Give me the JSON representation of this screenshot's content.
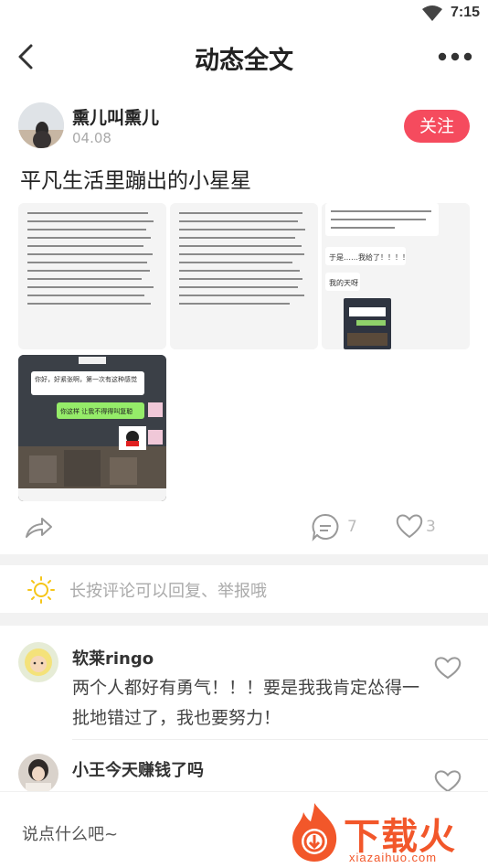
{
  "status_bar": {
    "time": "7:15"
  },
  "nav": {
    "title": "动态全文"
  },
  "post": {
    "author_name": "熏儿叫熏儿",
    "date": "04.08",
    "follow_label": "关注",
    "title": "平凡生活里蹦出的小星星",
    "comment_count": "7",
    "like_count": "3"
  },
  "screenshot_texts": {
    "chat_greeting": "你好，好紧张啊，第一次有这种感觉",
    "chat_reply": "你这样 让我不得得叫复聪",
    "reply_1": "于是……我给了！！！！",
    "reply_2": "我的天呀"
  },
  "tip": {
    "text": "长按评论可以回复、举报哦"
  },
  "comments": [
    {
      "name": "软莱ringo",
      "text": "两个人都好有勇气！！！要是我我肯定怂得一批地错过了，我也要努力！"
    },
    {
      "name": "小王今天赚钱了吗",
      "text": ""
    }
  ],
  "input": {
    "placeholder": "说点什么吧~"
  },
  "watermark": {
    "main": "下载火",
    "sub": "xiazaihuo.com"
  },
  "colors": {
    "accent": "#f54b5e",
    "watermark": "#f2572a",
    "tip_bulb": "#f5c518"
  }
}
